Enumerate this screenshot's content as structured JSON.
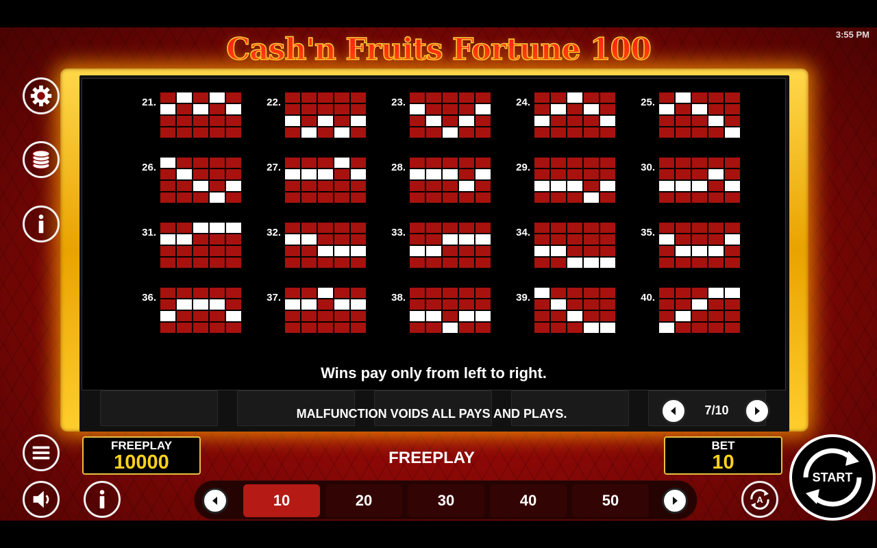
{
  "status_bar": {
    "time": "3:55 PM"
  },
  "game": {
    "title": "Cash'n Fruits Fortune 100"
  },
  "paylines": [
    {
      "num": "21.",
      "grid": [
        [
          0,
          1,
          0,
          1,
          0
        ],
        [
          1,
          0,
          1,
          0,
          1
        ],
        [
          0,
          0,
          0,
          0,
          0
        ],
        [
          0,
          0,
          0,
          0,
          0
        ]
      ]
    },
    {
      "num": "22.",
      "grid": [
        [
          0,
          0,
          0,
          0,
          0
        ],
        [
          0,
          0,
          0,
          0,
          0
        ],
        [
          1,
          0,
          1,
          0,
          1
        ],
        [
          0,
          1,
          0,
          1,
          0
        ]
      ]
    },
    {
      "num": "23.",
      "grid": [
        [
          0,
          0,
          0,
          0,
          0
        ],
        [
          1,
          0,
          0,
          0,
          1
        ],
        [
          0,
          1,
          0,
          1,
          0
        ],
        [
          0,
          0,
          1,
          0,
          0
        ]
      ]
    },
    {
      "num": "24.",
      "grid": [
        [
          0,
          0,
          1,
          0,
          0
        ],
        [
          0,
          1,
          0,
          1,
          0
        ],
        [
          1,
          0,
          0,
          0,
          1
        ],
        [
          0,
          0,
          0,
          0,
          0
        ]
      ]
    },
    {
      "num": "25.",
      "grid": [
        [
          0,
          1,
          0,
          0,
          0
        ],
        [
          1,
          0,
          1,
          0,
          0
        ],
        [
          0,
          0,
          0,
          1,
          0
        ],
        [
          0,
          0,
          0,
          0,
          1
        ]
      ]
    },
    {
      "num": "26.",
      "grid": [
        [
          1,
          0,
          0,
          0,
          0
        ],
        [
          0,
          1,
          0,
          0,
          0
        ],
        [
          0,
          0,
          1,
          0,
          1
        ],
        [
          0,
          0,
          0,
          1,
          0
        ]
      ]
    },
    {
      "num": "27.",
      "grid": [
        [
          0,
          0,
          0,
          1,
          0
        ],
        [
          1,
          1,
          1,
          0,
          1
        ],
        [
          0,
          0,
          0,
          0,
          0
        ],
        [
          0,
          0,
          0,
          0,
          0
        ]
      ]
    },
    {
      "num": "28.",
      "grid": [
        [
          0,
          0,
          0,
          0,
          0
        ],
        [
          1,
          1,
          1,
          0,
          1
        ],
        [
          0,
          0,
          0,
          1,
          0
        ],
        [
          0,
          0,
          0,
          0,
          0
        ]
      ]
    },
    {
      "num": "29.",
      "grid": [
        [
          0,
          0,
          0,
          0,
          0
        ],
        [
          0,
          0,
          0,
          0,
          0
        ],
        [
          1,
          1,
          1,
          0,
          1
        ],
        [
          0,
          0,
          0,
          1,
          0
        ]
      ]
    },
    {
      "num": "30.",
      "grid": [
        [
          0,
          0,
          0,
          0,
          0
        ],
        [
          0,
          0,
          0,
          1,
          0
        ],
        [
          1,
          1,
          1,
          0,
          1
        ],
        [
          0,
          0,
          0,
          0,
          0
        ]
      ]
    },
    {
      "num": "31.",
      "grid": [
        [
          0,
          0,
          1,
          1,
          1
        ],
        [
          1,
          1,
          0,
          0,
          0
        ],
        [
          0,
          0,
          0,
          0,
          0
        ],
        [
          0,
          0,
          0,
          0,
          0
        ]
      ]
    },
    {
      "num": "32.",
      "grid": [
        [
          0,
          0,
          0,
          0,
          0
        ],
        [
          1,
          1,
          0,
          0,
          0
        ],
        [
          0,
          0,
          1,
          1,
          1
        ],
        [
          0,
          0,
          0,
          0,
          0
        ]
      ]
    },
    {
      "num": "33.",
      "grid": [
        [
          0,
          0,
          0,
          0,
          0
        ],
        [
          0,
          0,
          1,
          1,
          1
        ],
        [
          1,
          1,
          0,
          0,
          0
        ],
        [
          0,
          0,
          0,
          0,
          0
        ]
      ]
    },
    {
      "num": "34.",
      "grid": [
        [
          0,
          0,
          0,
          0,
          0
        ],
        [
          0,
          0,
          0,
          0,
          0
        ],
        [
          1,
          1,
          0,
          0,
          0
        ],
        [
          0,
          0,
          1,
          1,
          1
        ]
      ]
    },
    {
      "num": "35.",
      "grid": [
        [
          0,
          0,
          0,
          0,
          0
        ],
        [
          1,
          0,
          0,
          0,
          1
        ],
        [
          0,
          1,
          1,
          1,
          0
        ],
        [
          0,
          0,
          0,
          0,
          0
        ]
      ]
    },
    {
      "num": "36.",
      "grid": [
        [
          0,
          0,
          0,
          0,
          0
        ],
        [
          0,
          1,
          1,
          1,
          0
        ],
        [
          1,
          0,
          0,
          0,
          1
        ],
        [
          0,
          0,
          0,
          0,
          0
        ]
      ]
    },
    {
      "num": "37.",
      "grid": [
        [
          0,
          0,
          1,
          0,
          0
        ],
        [
          1,
          1,
          0,
          1,
          1
        ],
        [
          0,
          0,
          0,
          0,
          0
        ],
        [
          0,
          0,
          0,
          0,
          0
        ]
      ]
    },
    {
      "num": "38.",
      "grid": [
        [
          0,
          0,
          0,
          0,
          0
        ],
        [
          0,
          0,
          0,
          0,
          0
        ],
        [
          1,
          1,
          0,
          1,
          1
        ],
        [
          0,
          0,
          1,
          0,
          0
        ]
      ]
    },
    {
      "num": "39.",
      "grid": [
        [
          1,
          0,
          0,
          0,
          0
        ],
        [
          0,
          1,
          0,
          0,
          0
        ],
        [
          0,
          0,
          1,
          0,
          0
        ],
        [
          0,
          0,
          0,
          1,
          1
        ]
      ]
    },
    {
      "num": "40.",
      "grid": [
        [
          0,
          0,
          0,
          1,
          1
        ],
        [
          0,
          0,
          1,
          0,
          0
        ],
        [
          0,
          1,
          0,
          0,
          0
        ],
        [
          1,
          0,
          0,
          0,
          0
        ]
      ]
    }
  ],
  "paytable": {
    "note": "Wins pay only from left to right.",
    "page": "7/10"
  },
  "disclaimer": "MALFUNCTION VOIDS ALL PAYS AND PLAYS.",
  "meters": {
    "balance_label": "FREEPLAY",
    "balance_value": "10000",
    "bet_label": "BET",
    "bet_value": "10"
  },
  "center_label": "FREEPLAY",
  "bet_options": [
    "10",
    "20",
    "30",
    "40",
    "50"
  ],
  "bet_selected": "10",
  "start_label": "START",
  "colors": {
    "line_cell": "#a8120e",
    "line_cell_on": "#ffffff",
    "gold": "#e8c040",
    "meter_value": "#ffd21e",
    "bet_active": "#b51a14"
  }
}
